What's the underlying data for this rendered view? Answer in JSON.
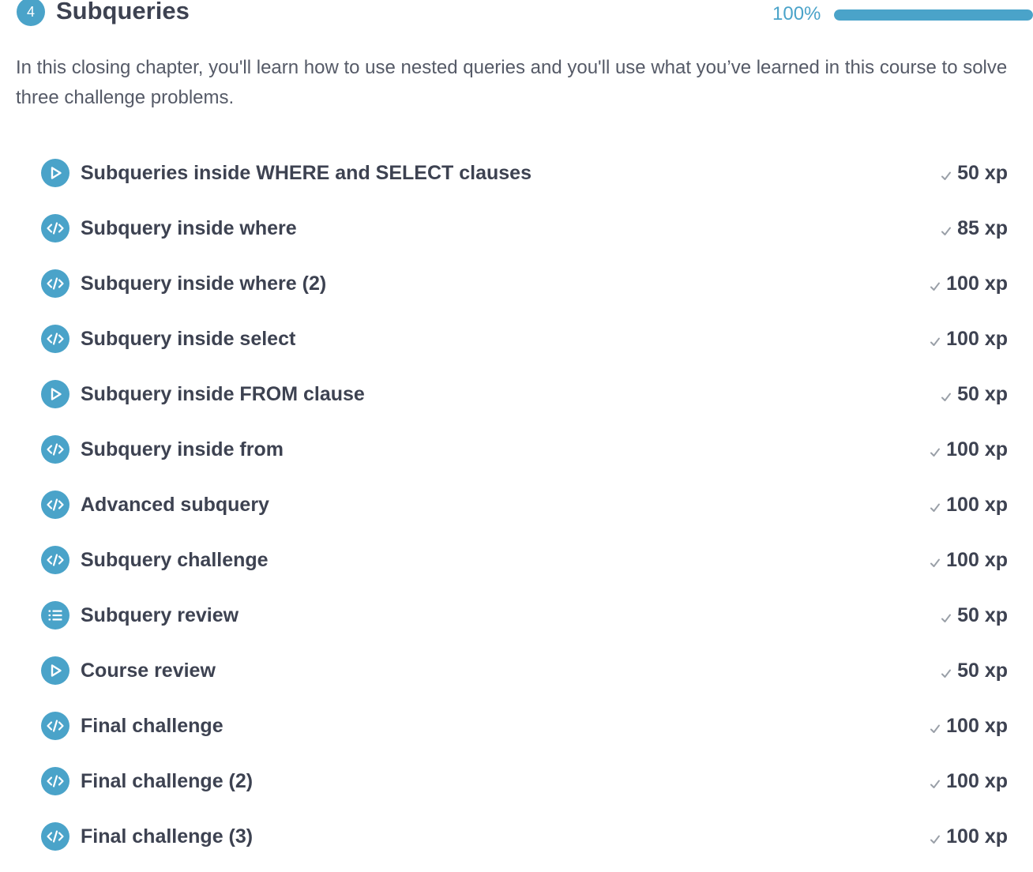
{
  "chapter": {
    "number": "4",
    "title": "Subqueries",
    "progress_label": "100%",
    "progress_fraction": 1.0,
    "description": "In this closing chapter, you'll learn how to use nested queries and you'll use what you’ve learned in this course to solve three challenge problems."
  },
  "colors": {
    "accent": "#4aa3c9",
    "text": "#3d4251",
    "check": "#9aa0a8"
  },
  "exercises": [
    {
      "icon": "video-play-icon",
      "title": "Subqueries inside WHERE and SELECT clauses",
      "xp": "50 xp",
      "completed": true
    },
    {
      "icon": "code-icon",
      "title": "Subquery inside where",
      "xp": "85 xp",
      "completed": true
    },
    {
      "icon": "code-icon",
      "title": "Subquery inside where (2)",
      "xp": "100 xp",
      "completed": true
    },
    {
      "icon": "code-icon",
      "title": "Subquery inside select",
      "xp": "100 xp",
      "completed": true
    },
    {
      "icon": "video-play-icon",
      "title": "Subquery inside FROM clause",
      "xp": "50 xp",
      "completed": true
    },
    {
      "icon": "code-icon",
      "title": "Subquery inside from",
      "xp": "100 xp",
      "completed": true
    },
    {
      "icon": "code-icon",
      "title": "Advanced subquery",
      "xp": "100 xp",
      "completed": true
    },
    {
      "icon": "code-icon",
      "title": "Subquery challenge",
      "xp": "100 xp",
      "completed": true
    },
    {
      "icon": "multiple-choice-list-icon",
      "title": "Subquery review",
      "xp": "50 xp",
      "completed": true
    },
    {
      "icon": "video-play-icon",
      "title": "Course review",
      "xp": "50 xp",
      "completed": true
    },
    {
      "icon": "code-icon",
      "title": "Final challenge",
      "xp": "100 xp",
      "completed": true
    },
    {
      "icon": "code-icon",
      "title": "Final challenge (2)",
      "xp": "100 xp",
      "completed": true
    },
    {
      "icon": "code-icon",
      "title": "Final challenge (3)",
      "xp": "100 xp",
      "completed": true
    }
  ]
}
